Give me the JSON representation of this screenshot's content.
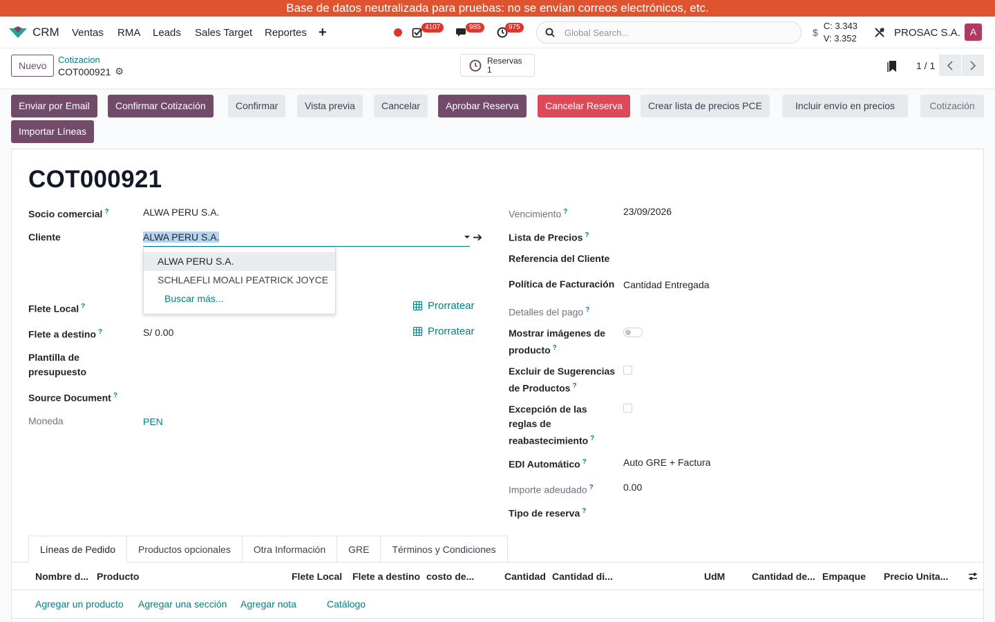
{
  "banner": "Base de datos neutralizada para pruebas: no se envían correos electrónicos, etc.",
  "navbar": {
    "app_name": "CRM",
    "menu": [
      "Ventas",
      "RMA",
      "Leads",
      "Sales Target",
      "Reportes"
    ],
    "plus": "+",
    "badges": {
      "activities": "4107",
      "messages": "985",
      "timers": "975"
    },
    "search_placeholder": "Global Search...",
    "rate_symbol": "$",
    "rate_c": "C: 3.343",
    "rate_v": "V: 3.352",
    "company": "PROSAC S.A.",
    "avatar_letter": "A"
  },
  "control": {
    "new_button": "Nuevo",
    "breadcrumb_parent": "Cotizacion",
    "breadcrumb_current": "COT000921",
    "reservas_label": "Reservas",
    "reservas_count": "1",
    "pager": "1 / 1"
  },
  "actions": {
    "enviar_email": "Enviar por Email",
    "confirmar_cotizacion": "Confirmar Cotización",
    "confirmar": "Confirmar",
    "vista_previa": "Vista previa",
    "cancelar": "Cancelar",
    "aprobar_reserva": "Aprobar Reserva",
    "cancelar_reserva": "Cancelar Reserva",
    "crear_lista": "Crear lista de precios PCE",
    "incluir_envio": "Incluir envío en precios",
    "status": "Cotización",
    "importar_lineas": "Importar Líneas"
  },
  "form": {
    "title": "COT000921",
    "left": {
      "socio_label": "Socio comercial",
      "socio_value": "ALWA PERU S.A.",
      "cliente_label": "Cliente",
      "cliente_value": "ALWA PERU S.A.",
      "flete_local_label": "Flete Local",
      "flete_destino_label": "Flete a destino",
      "flete_destino_value": "S/ 0.00",
      "prorratear": "Prorratear",
      "plantilla_label_1": "Plantilla de",
      "plantilla_label_2": "presupuesto",
      "source_label": "Source Document",
      "moneda_label": "Moneda",
      "moneda_value": "PEN"
    },
    "dropdown": {
      "items": [
        "ALWA PERU S.A.",
        "SCHLAEFLI MOALI PEATRICK JOYCE"
      ],
      "more": "Buscar más..."
    },
    "right": {
      "vencimiento_label": "Vencimiento",
      "vencimiento_value": "23/09/2026",
      "lista_precios_label": "Lista de Precios",
      "referencia_label": "Referencia del Cliente",
      "politica_label": "Política de Facturación",
      "politica_value": "Cantidad Entregada",
      "detalles_pago_label": "Detalles del pago",
      "mostrar_img_label_1": "Mostrar imágenes de",
      "mostrar_img_label_2": "producto",
      "excluir_label_1": "Excluir de Sugerencias",
      "excluir_label_2": "de Productos",
      "excepcion_label_1": "Excepción de las",
      "excepcion_label_2": "reglas de",
      "excepcion_label_3": "reabastecimiento",
      "edi_label": "EDI Automático",
      "edi_value": "Auto GRE + Factura",
      "importe_label": "Importe adeudado",
      "importe_value": "0.00",
      "tipo_reserva_label": "Tipo de reserva"
    },
    "help_mark": "?"
  },
  "tabs": [
    "Líneas de Pedido",
    "Productos opcionales",
    "Otra Información",
    "GRE",
    "Términos y Condiciones"
  ],
  "table": {
    "columns": [
      "Nombre d...",
      "Producto",
      "Flete Local",
      "Flete a destino",
      "costo de...",
      "Cantidad",
      "Cantidad di...",
      "UdM",
      "Cantidad de...",
      "Empaque",
      "Precio Unita..."
    ],
    "add_product": "Agregar un producto",
    "add_section": "Agregar una sección",
    "add_note": "Agregar nota",
    "catalog": "Catálogo"
  },
  "colors": {
    "primary": "#714b67",
    "link": "#017e84",
    "danger": "#dc4a5a",
    "banner": "#e0532f"
  }
}
